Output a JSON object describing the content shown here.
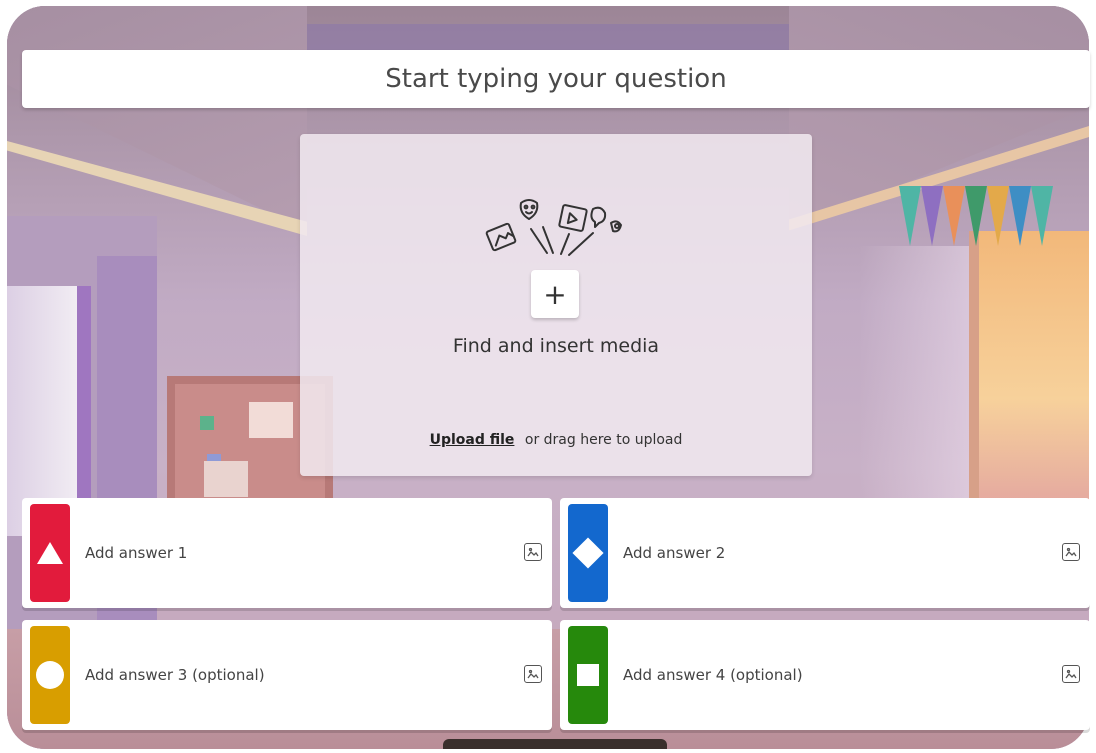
{
  "question": {
    "placeholder": "Start typing your question"
  },
  "media": {
    "icon": "media-collage-icon",
    "insert_icon": "plus-icon",
    "insert_glyph": "+",
    "title": "Find and insert media",
    "upload_link": "Upload file",
    "upload_hint": "or drag here to upload"
  },
  "answers": [
    {
      "label": "Add answer 1",
      "shape": "triangle-icon",
      "color": "#e21b3c"
    },
    {
      "label": "Add answer 2",
      "shape": "diamond-icon",
      "color": "#1368ce"
    },
    {
      "label": "Add answer 3 (optional)",
      "shape": "circle-icon",
      "color": "#d89e00"
    },
    {
      "label": "Add answer 4 (optional)",
      "shape": "square-icon",
      "color": "#26890c"
    }
  ],
  "colors": {
    "answer_red": "#e21b3c",
    "answer_blue": "#1368ce",
    "answer_yellow": "#d89e00",
    "answer_green": "#26890c"
  }
}
